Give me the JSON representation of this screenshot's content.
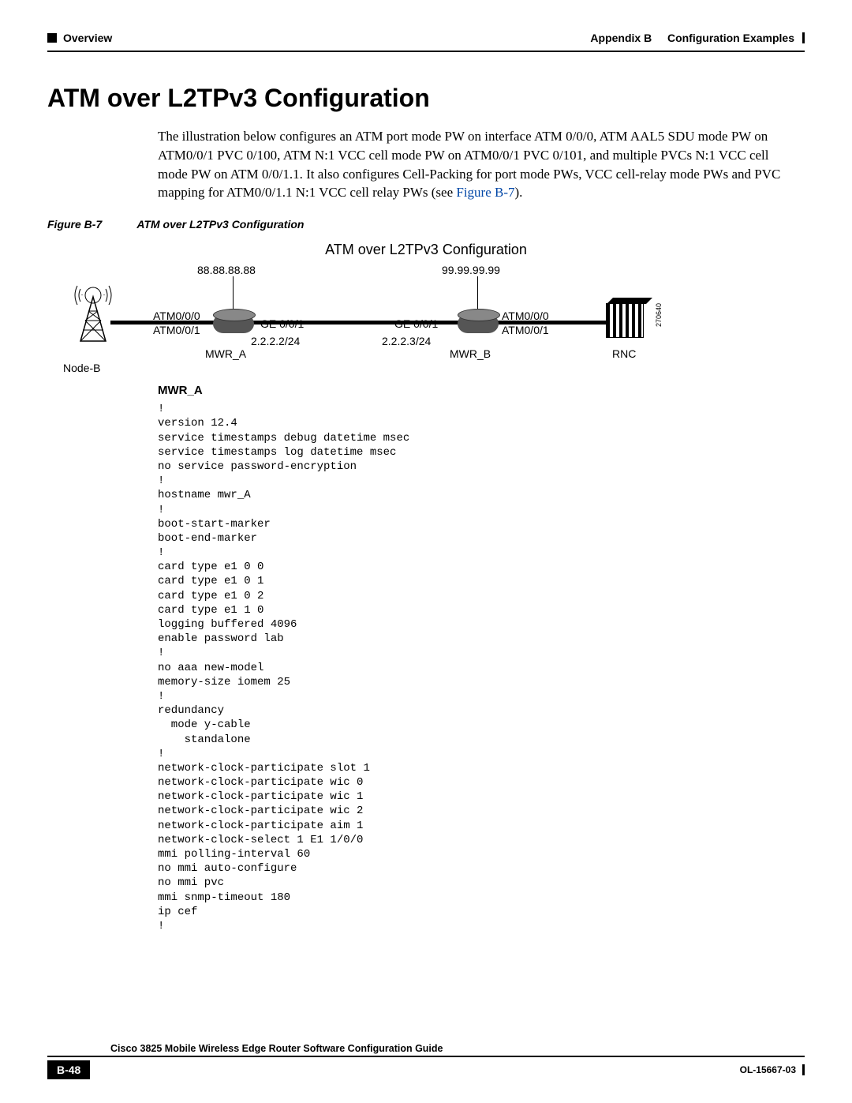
{
  "header": {
    "left_label": "Overview",
    "appendix": "Appendix B",
    "appendix_title": "Configuration Examples"
  },
  "section": {
    "title": "ATM over L2TPv3 Configuration",
    "paragraph": "The illustration below configures an ATM port mode PW on interface ATM 0/0/0, ATM AAL5 SDU mode PW on ATM0/0/1 PVC 0/100, ATM N:1 VCC cell mode PW on ATM0/0/1 PVC 0/101, and multiple PVCs N:1 VCC cell mode PW on ATM 0/0/1.1. It also configures Cell-Packing for port mode PWs, VCC cell-relay mode PWs and PVC mapping for ATM0/0/1.1 N:1 VCC cell relay PWs (see ",
    "figlink": "Figure B-7",
    "after_link": ")."
  },
  "figure": {
    "number": "Figure B-7",
    "caption": "ATM over L2TPv3 Configuration",
    "diag_title": "ATM over L2TPv3 Configuration",
    "ip_left": "88.88.88.88",
    "ip_right": "99.99.99.99",
    "node_b": "Node-B",
    "mwr_a": "MWR_A",
    "mwr_b": "MWR_B",
    "rnc": "RNC",
    "atm000_l": "ATM0/0/0",
    "atm001_l": "ATM0/0/1",
    "ge001_l": "GE 0/0/1",
    "ge001_r": "GE 0/0/1",
    "atm000_r": "ATM0/0/0",
    "atm001_r": "ATM0/0/1",
    "subnet_l": "2.2.2.2/24",
    "subnet_r": "2.2.2.3/24",
    "side_num": "270640"
  },
  "config": {
    "heading": "MWR_A",
    "text": "!\nversion 12.4\nservice timestamps debug datetime msec\nservice timestamps log datetime msec\nno service password-encryption\n!\nhostname mwr_A\n!\nboot-start-marker\nboot-end-marker\n!\ncard type e1 0 0\ncard type e1 0 1\ncard type e1 0 2\ncard type e1 1 0\nlogging buffered 4096\nenable password lab\n!\nno aaa new-model\nmemory-size iomem 25\n!\nredundancy\n  mode y-cable\n    standalone\n!\nnetwork-clock-participate slot 1\nnetwork-clock-participate wic 0\nnetwork-clock-participate wic 1\nnetwork-clock-participate wic 2\nnetwork-clock-participate aim 1\nnetwork-clock-select 1 E1 1/0/0\nmmi polling-interval 60\nno mmi auto-configure\nno mmi pvc\nmmi snmp-timeout 180\nip cef\n!"
  },
  "footer": {
    "guide_title": "Cisco 3825 Mobile Wireless Edge Router Software Configuration Guide",
    "page": "B-48",
    "doc_id": "OL-15667-03"
  }
}
